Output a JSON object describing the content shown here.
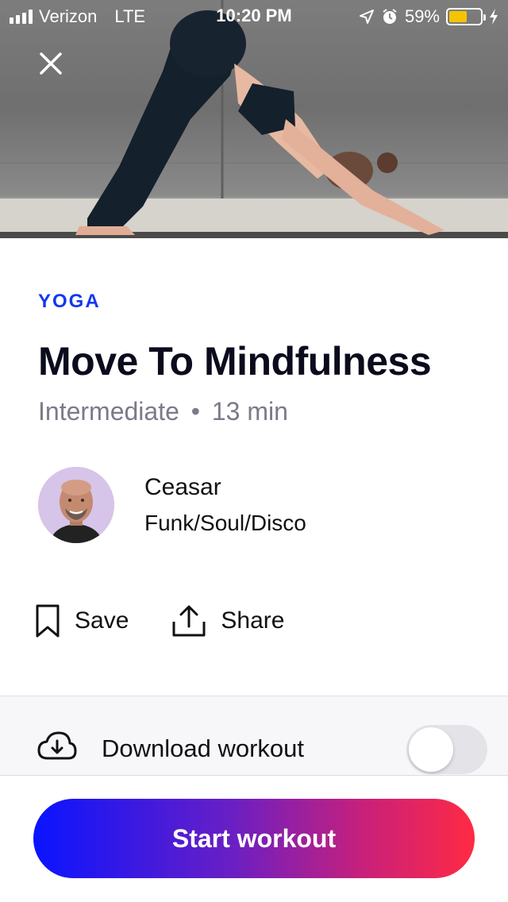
{
  "status_bar": {
    "carrier": "Verizon",
    "network": "LTE",
    "time": "10:20 PM",
    "battery_percent": "59%",
    "battery_level": 0.59
  },
  "workout": {
    "category": "YOGA",
    "title": "Move To Mindfulness",
    "level": "Intermediate",
    "separator": "•",
    "duration": "13 min"
  },
  "instructor": {
    "name": "Ceasar",
    "music": "Funk/Soul/Disco"
  },
  "actions": {
    "save_label": "Save",
    "share_label": "Share"
  },
  "download": {
    "label": "Download workout",
    "enabled": false
  },
  "start_button": {
    "label": "Start workout"
  },
  "colors": {
    "accent": "#1438f0",
    "gradient_start": "#0a14ff",
    "gradient_end": "#ff2a44"
  }
}
